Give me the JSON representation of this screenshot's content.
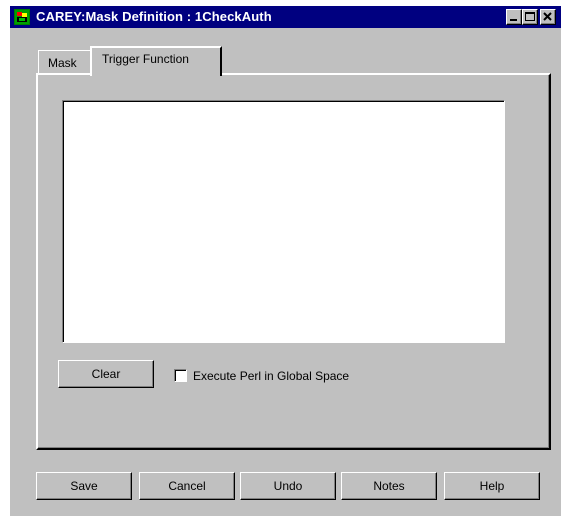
{
  "window": {
    "title": "CAREY:Mask Definition  : 1CheckAuth",
    "controls": [
      "minimize-icon",
      "maximize-icon",
      "close-icon"
    ]
  },
  "tabs": [
    {
      "label": "Mask",
      "selected": false
    },
    {
      "label": "Trigger Function",
      "selected": true
    }
  ],
  "trigger_function": {
    "editor_text": "",
    "clear_label": "Clear",
    "execute_global_label": "Execute Perl in Global Space",
    "execute_global_checked": false
  },
  "footer": {
    "save_label": "Save",
    "cancel_label": "Cancel",
    "undo_label": "Undo",
    "notes_label": "Notes",
    "help_label": "Help"
  },
  "colors": {
    "titlebar": "#000080",
    "face": "#c0c0c0"
  }
}
